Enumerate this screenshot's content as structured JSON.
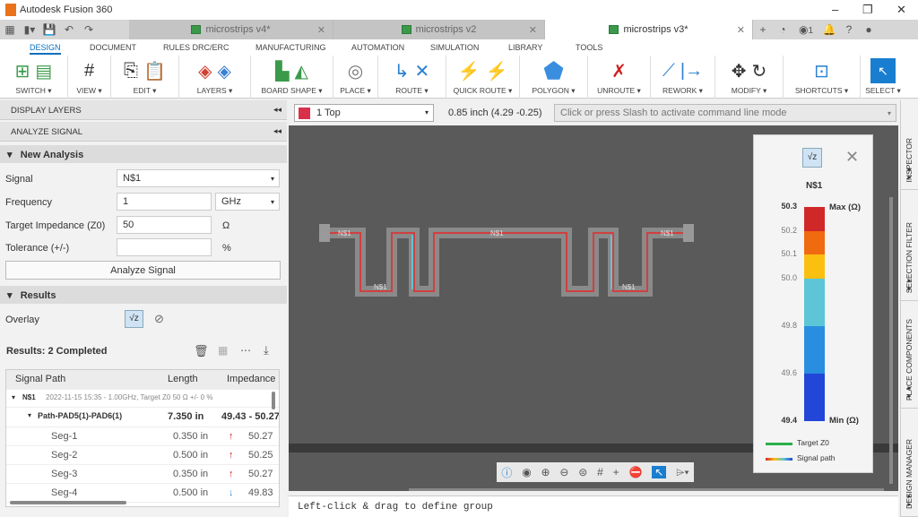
{
  "app": {
    "title": "Autodesk Fusion 360"
  },
  "doc_tabs": [
    {
      "label": "microstrips v4*"
    },
    {
      "label": "microstrips v2"
    },
    {
      "label": "microstrips v3*"
    }
  ],
  "notif_count": "1",
  "ribbon_tabs": [
    "DESIGN",
    "DOCUMENT",
    "RULES DRC/ERC",
    "MANUFACTURING",
    "AUTOMATION",
    "SIMULATION",
    "LIBRARY",
    "TOOLS"
  ],
  "ribbon_groups": [
    "SWITCH ▾",
    "VIEW ▾",
    "EDIT ▾",
    "LAYERS ▾",
    "BOARD SHAPE ▾",
    "PLACE ▾",
    "ROUTE ▾",
    "QUICK ROUTE ▾",
    "POLYGON ▾",
    "UNROUTE ▾",
    "REWORK ▾",
    "MODIFY ▾",
    "SHORTCUTS ▾",
    "SELECT ▾"
  ],
  "left": {
    "display_layers": "DISPLAY LAYERS",
    "analyze_signal": "ANALYZE SIGNAL",
    "new_analysis": "New Analysis",
    "signal_label": "Signal",
    "signal_value": "N$1",
    "frequency_label": "Frequency",
    "frequency_value": "1",
    "frequency_unit": "GHz",
    "impedance_label": "Target Impedance (Z0)",
    "impedance_value": "50",
    "impedance_unit": "Ω",
    "tolerance_label": "Tolerance (+/-)",
    "tolerance_value": "",
    "tolerance_unit": "%",
    "analyze_button": "Analyze Signal",
    "results": "Results",
    "overlay": "Overlay",
    "results_count": "Results: 2 Completed"
  },
  "table": {
    "headers": [
      "Signal Path",
      "Length",
      "Impedance"
    ],
    "net": {
      "name": "N$1",
      "info": "2022-11-15 15:35 - 1.00GHz, Target Z0 50 Ω +/- 0 %"
    },
    "path": {
      "name": "Path-PAD5(1)-PAD6(1)",
      "length": "7.350 in",
      "impedance": "49.43 - 50.27"
    },
    "segments": [
      {
        "name": "Seg-1",
        "length": "0.350 in",
        "dir": "up",
        "impedance": "50.27"
      },
      {
        "name": "Seg-2",
        "length": "0.500 in",
        "dir": "up",
        "impedance": "50.25"
      },
      {
        "name": "Seg-3",
        "length": "0.350 in",
        "dir": "up",
        "impedance": "50.27"
      },
      {
        "name": "Seg-4",
        "length": "0.500 in",
        "dir": "down",
        "impedance": "49.83"
      }
    ]
  },
  "cmd": {
    "layer": "1 Top",
    "layer_color": "#d9304a",
    "coords": "0.85 inch (4.29 -0.25)",
    "placeholder": "Click or press Slash to activate command line mode"
  },
  "canvas": {
    "net_label": "N$1"
  },
  "legend": {
    "net": "N$1",
    "max_label": "Max (Ω)",
    "min_label": "Min (Ω)",
    "ticks": [
      "50.3",
      "50.2",
      "50.1",
      "50.0",
      "49.8",
      "49.6",
      "49.4"
    ],
    "bands": [
      {
        "from": 50.2,
        "to": 50.3,
        "color": "#d02828"
      },
      {
        "from": 50.1,
        "to": 50.2,
        "color": "#f06a10"
      },
      {
        "from": 50.0,
        "to": 50.1,
        "color": "#fbbf10"
      },
      {
        "from": 49.8,
        "to": 50.0,
        "color": "#5cc6d6"
      },
      {
        "from": 49.6,
        "to": 49.8,
        "color": "#2a8ee0"
      },
      {
        "from": 49.4,
        "to": 49.6,
        "color": "#2246d8"
      }
    ],
    "target": "Target Z0",
    "signal": "Signal path"
  },
  "right_tabs": [
    "INSPECTOR",
    "SELECTION FILTER",
    "PLACE COMPONENTS",
    "DESIGN MANAGER"
  ],
  "status": "Left-click & drag to define group"
}
